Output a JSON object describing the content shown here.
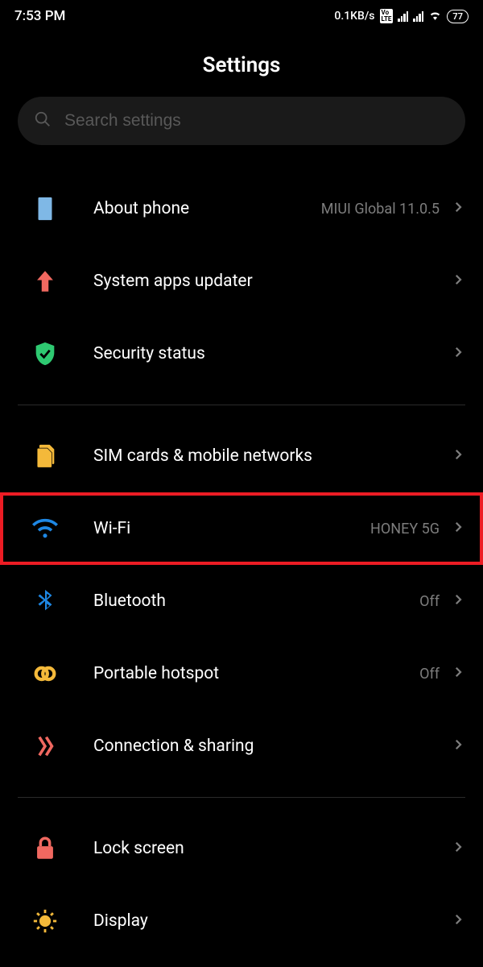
{
  "status_bar": {
    "time": "7:53 PM",
    "network_speed": "0.1KB/s",
    "battery": "77"
  },
  "page_title": "Settings",
  "search": {
    "placeholder": "Search settings"
  },
  "section1": [
    {
      "label": "About phone",
      "detail": "MIUI Global 11.0.5"
    },
    {
      "label": "System apps updater",
      "detail": ""
    },
    {
      "label": "Security status",
      "detail": ""
    }
  ],
  "section2": [
    {
      "label": "SIM cards & mobile networks",
      "detail": ""
    },
    {
      "label": "Wi-Fi",
      "detail": "HONEY 5G"
    },
    {
      "label": "Bluetooth",
      "detail": "Off"
    },
    {
      "label": "Portable hotspot",
      "detail": "Off"
    },
    {
      "label": "Connection & sharing",
      "detail": ""
    }
  ],
  "section3": [
    {
      "label": "Lock screen",
      "detail": ""
    },
    {
      "label": "Display",
      "detail": ""
    }
  ]
}
